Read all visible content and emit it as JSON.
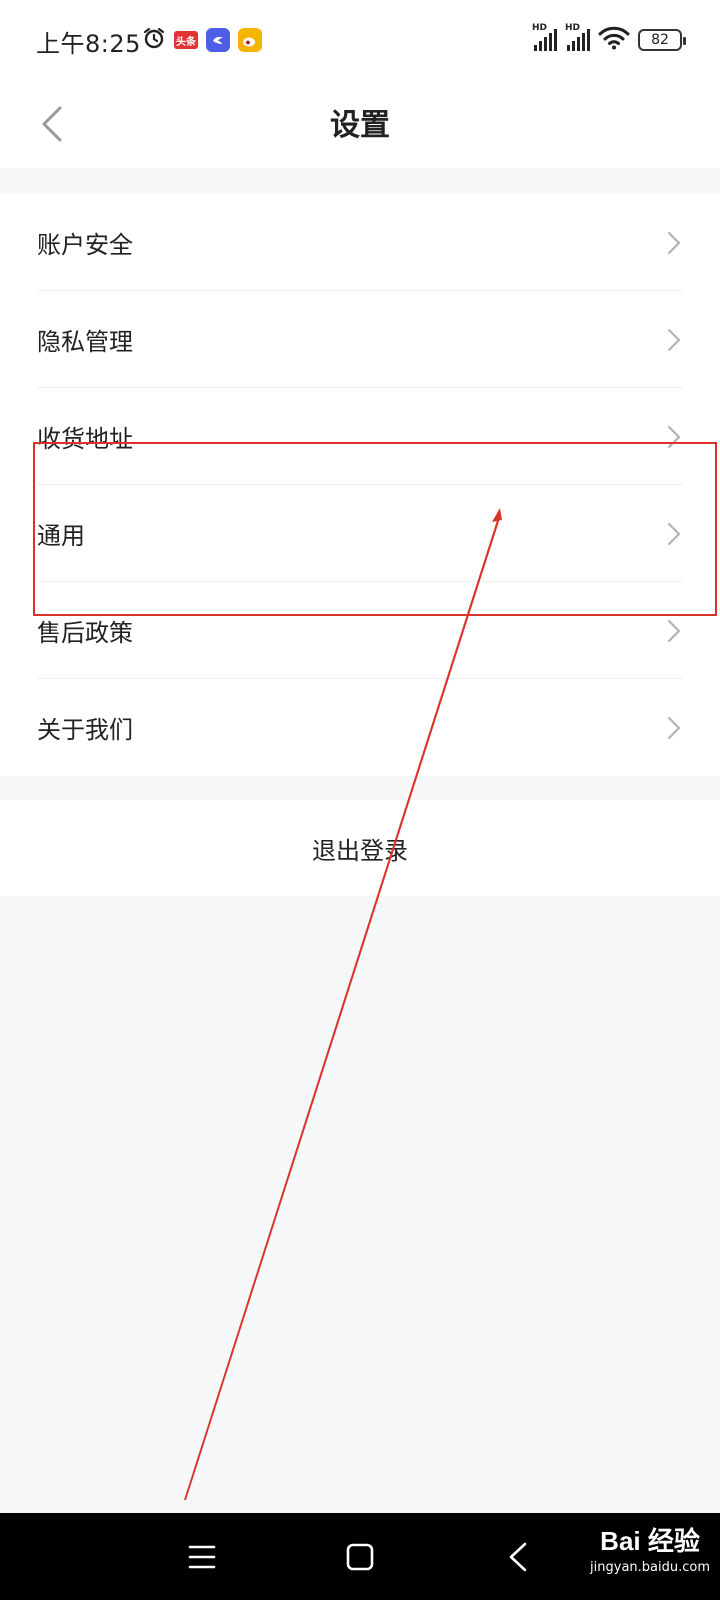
{
  "status_bar": {
    "time": "上午8:25",
    "app_icons": [
      {
        "name": "alarm-icon"
      },
      {
        "name": "toutiao-icon",
        "label": "头条",
        "color": "#e03434"
      },
      {
        "name": "bird-app-icon",
        "color": "#4f5ee8"
      },
      {
        "name": "weibo-icon",
        "color": "#f5b400"
      }
    ],
    "signal_label": "HD",
    "battery": "82"
  },
  "nav": {
    "title": "设置",
    "back_icon": "chevron-left-icon"
  },
  "menu": {
    "items": [
      {
        "label": "账户安全"
      },
      {
        "label": "隐私管理"
      },
      {
        "label": "收货地址"
      },
      {
        "label": "通用"
      },
      {
        "label": "售后政策"
      },
      {
        "label": "关于我们"
      }
    ]
  },
  "logout": {
    "label": "退出登录"
  },
  "system_nav": {
    "icons": [
      "menu-icon",
      "home-square-icon",
      "back-icon"
    ]
  },
  "watermark": {
    "main": "Bai 经验",
    "sub": "jingyan.baidu.com"
  },
  "annotation": {
    "color": "#d9342b"
  }
}
